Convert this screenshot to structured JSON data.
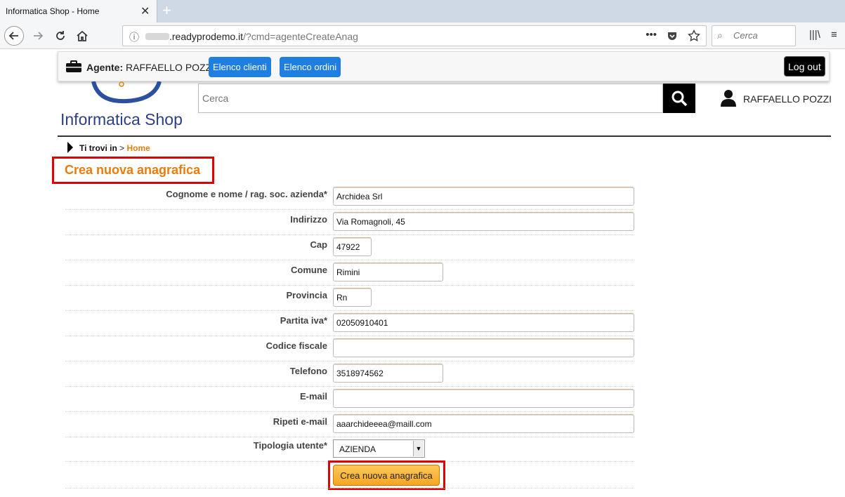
{
  "browser": {
    "tab_title": "Informatica Shop - Home",
    "url_domain": ".readyprodemo.it",
    "url_path": "/?cmd=agenteCreateAnag",
    "search_placeholder": "Cerca"
  },
  "agentbar": {
    "agent_label": "Agente:",
    "agent_name": "RAFFAELLO POZZI",
    "btn_clients": "Elenco clienti",
    "btn_orders": "Elenco ordini",
    "btn_logout": "Log out"
  },
  "header": {
    "logo_text": "Informatica Shop",
    "search_placeholder": "Cerca",
    "user_name": "RAFFAELLO POZZI"
  },
  "breadcrumb": {
    "label": "Ti trovi in",
    "separator": ">",
    "current": "Home"
  },
  "page_title": "Crea nuova anagrafica",
  "form": {
    "fields": [
      {
        "label": "Cognome e nome / rag. soc. azienda*",
        "value": "Archidea Srl"
      },
      {
        "label": "Indirizzo",
        "value": "Via Romagnoli, 45"
      },
      {
        "label": "Cap",
        "value": "47922"
      },
      {
        "label": "Comune",
        "value": "Rimini"
      },
      {
        "label": "Provincia",
        "value": "Rn"
      },
      {
        "label": "Partita iva*",
        "value": "02050910401"
      },
      {
        "label": "Codice fiscale",
        "value": ""
      },
      {
        "label": "Telefono",
        "value": "3518974562"
      },
      {
        "label": "E-mail",
        "value": ""
      },
      {
        "label": "Ripeti e-mail",
        "value": "aaarchideeea@maill.com"
      }
    ],
    "tipologia_label": "Tipologia utente*",
    "tipologia_value": "AZIENDA",
    "submit_label": "Crea nuova anagrafica"
  },
  "colors": {
    "accent_orange": "#e87c0c",
    "nav_blue": "#1e7fe0",
    "highlight_red": "#e00000"
  }
}
